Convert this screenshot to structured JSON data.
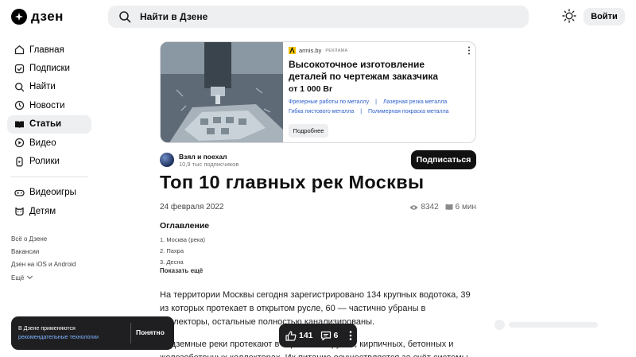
{
  "header": {
    "logo": "дзен",
    "search_placeholder": "Найти в Дзене",
    "login_label": "Войти"
  },
  "sidebar": {
    "items": [
      {
        "label": "Главная",
        "icon": "home-icon"
      },
      {
        "label": "Подписки",
        "icon": "subscriptions-icon"
      },
      {
        "label": "Найти",
        "icon": "search-icon"
      },
      {
        "label": "Новости",
        "icon": "news-icon"
      },
      {
        "label": "Статьи",
        "icon": "articles-icon",
        "active": true
      },
      {
        "label": "Видео",
        "icon": "video-icon"
      },
      {
        "label": "Ролики",
        "icon": "shorts-icon"
      }
    ],
    "items2": [
      {
        "label": "Видеоигры",
        "icon": "gamepad-icon"
      },
      {
        "label": "Детям",
        "icon": "kids-icon"
      }
    ],
    "footer_links": [
      "Всё о Дзене",
      "Вакансии",
      "Дзен на iOS и Android",
      "Ещё"
    ]
  },
  "ad": {
    "source": "armis.by",
    "tag": "РЕКЛАМА",
    "title": "Высокоточное изготовление деталей по чертежам заказчика",
    "price": "от 1 000 Br",
    "links": [
      "Фрезерные работы по металлу",
      "Лазерная резка металла",
      "Гибка листового металла",
      "Полимерная покраска металла"
    ],
    "button": "Подробнее"
  },
  "channel": {
    "name": "Взял и поехал",
    "subscribers": "10,9 тыс подписчиков",
    "subscribe_label": "Подписаться"
  },
  "article": {
    "title": "Топ 10 главных рек Москвы",
    "date": "24 февраля 2022",
    "views": "8342",
    "read_time": "6 мин",
    "toc_heading": "Оглавление",
    "toc": [
      "1. Москва (река)",
      "2. Пахра",
      "3. Десна"
    ],
    "toc_more": "Показать ещё",
    "paragraph1": "На территории Москвы сегодня зарегистрировано 134 крупных водотока, 39 из которых протекает в открытом русле, 60 — частично убраны в коллекторы, остальные полностью канализированы.",
    "paragraph2": "Подземные реки протекают в кирпичных трубах, кирпичных, бетонных и железобетонных коллекторах. Их питание осуществляется за счёт системы"
  },
  "cookie": {
    "text": "В Дзене применяются",
    "link": "рекомендательные технологии",
    "button": "Понятно"
  },
  "actions": {
    "likes": "141",
    "comments": "6"
  }
}
